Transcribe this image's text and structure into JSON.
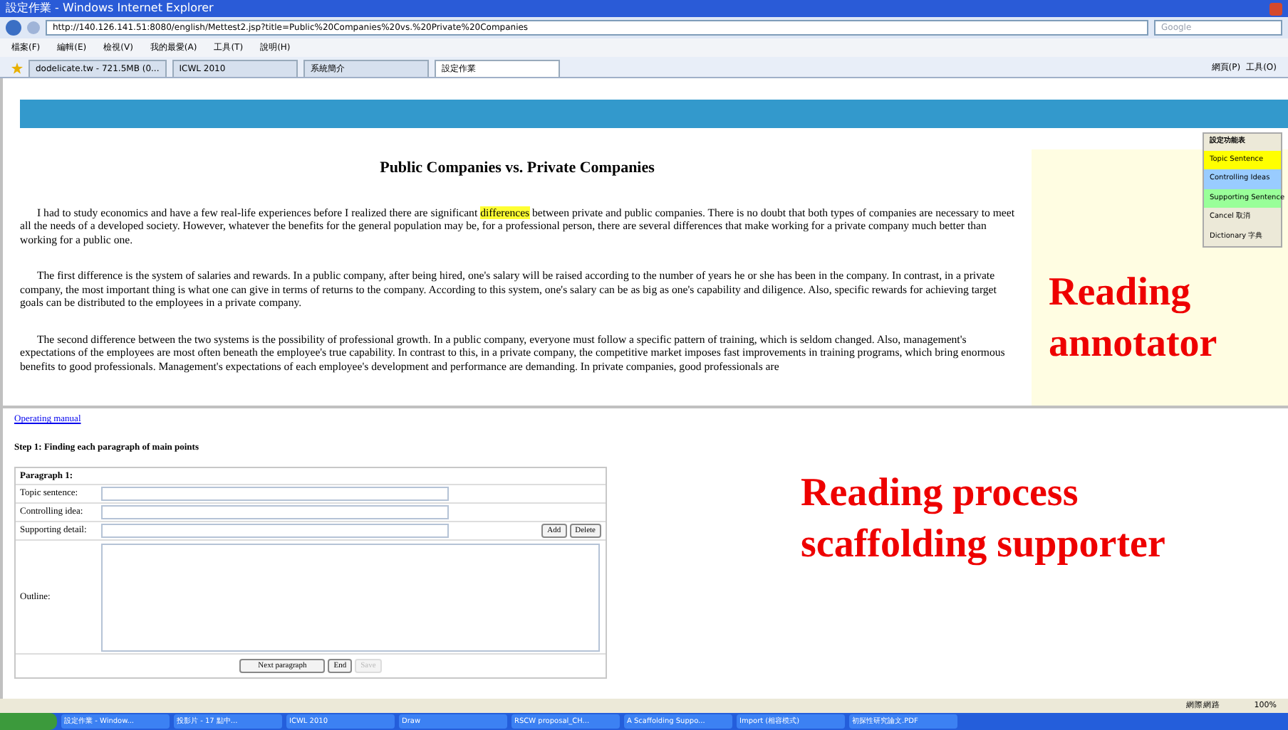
{
  "window": {
    "title": "設定作業 - Windows Internet Explorer"
  },
  "address_bar": {
    "url": "http://140.126.141.51:8080/english/Mettest2.jsp?title=Public%20Companies%20vs.%20Private%20Companies",
    "search_placeholder": "Google"
  },
  "menu_bar": [
    "檔案(F)",
    "編輯(E)",
    "檢視(V)",
    "我的最愛(A)",
    "工具(T)",
    "說明(H)"
  ],
  "tabs": [
    {
      "label": "dodelicate.tw - 721.5MB (0...",
      "selected": false
    },
    {
      "label": "ICWL 2010",
      "selected": false
    },
    {
      "label": "系統簡介",
      "selected": false
    },
    {
      "label": "設定作業",
      "selected": true
    }
  ],
  "toolbar_right": [
    "網頁(P)",
    "工具(O)"
  ],
  "article": {
    "title": "Public Companies vs. Private Companies",
    "paragraphs": [
      [
        {
          "text": "I had to study economics and have a few real-life experiences before I realized there are significant ",
          "highlight": false
        },
        {
          "text": "differences",
          "highlight": true
        },
        {
          "text": " between private and public companies. There is no doubt that both types of companies are necessary to meet all the needs of a developed society. However, whatever the benefits for the general population may be, for a professional person, there are several differences that make working for a private company much better than working for a public one.",
          "highlight": false
        }
      ],
      [
        {
          "text": "The first difference is the system of salaries and rewards. In a public company, after being hired, one's salary will be raised according to the number of years he or she has been in the company. In contrast, in a private company, the most important thing is what one can give in terms of returns to the company. According to this system, one's salary can be as big as one's capability and diligence. Also, specific rewards for achieving target goals can be distributed to the employees in a private company.",
          "highlight": false
        }
      ],
      [
        {
          "text": "The second difference between the two systems is the possibility of professional growth. In a public company, everyone must follow a specific pattern of training, which is seldom changed. Also, management's expectations of the employees are most often beneath the employee's true capability. In contrast to this, in a private company, the competitive market imposes fast improvements in training programs, which bring enormous benefits to good professionals. Management's expectations of each employee's development and performance are demanding. In private companies, good professionals are",
          "highlight": false
        }
      ]
    ]
  },
  "annotator_menu": {
    "title": "設定功能表",
    "items": [
      {
        "label": "Topic Sentence",
        "color": "#ffff00"
      },
      {
        "label": "Controlling Ideas",
        "color": "#99ccff"
      },
      {
        "label": "Supporting Sentence",
        "color": "#99ff99"
      },
      {
        "label": "Cancel  取消",
        "color": "#ece9d8"
      },
      {
        "label": "Dictionary  字典",
        "color": "#ece9d8"
      }
    ]
  },
  "annotations": [
    "Reading annotator",
    "Reading process scaffolding supporter"
  ],
  "supporter": {
    "manual_link": "Operating manual",
    "step": "Step 1: Finding each paragraph of main points",
    "paragraph_label": "Paragraph 1:",
    "fields": [
      {
        "label": "Topic sentence:",
        "kind": "text"
      },
      {
        "label": "Controlling idea:",
        "kind": "text"
      },
      {
        "label": "Supporting detail:",
        "kind": "buttons"
      }
    ],
    "detail_buttons": [
      "Add",
      "Delete"
    ],
    "outline_label": "Outline:",
    "buttons": [
      {
        "label": "Next paragraph",
        "disabled": false
      },
      {
        "label": "End",
        "disabled": false
      },
      {
        "label": "Save",
        "disabled": true
      }
    ]
  },
  "status_bar": {
    "zone": "網際網路",
    "zoom": "100%"
  },
  "taskbar": [
    "設定作業 - Window...",
    "投影片 - 17 點中...",
    "ICWL 2010",
    "Draw",
    "RSCW proposal_CH...",
    "A Scaffolding Suppo...",
    "Import (相容模式)",
    "初探性研究論文.PDF"
  ]
}
